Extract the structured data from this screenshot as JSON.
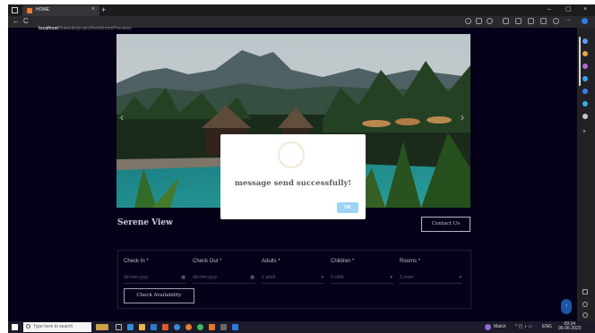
{
  "browser": {
    "tab_title": "HOME",
    "tab_close": "×",
    "new_tab": "+",
    "url_host": "localhost",
    "url_path": "/hotelsite/project/hotel/roomPreviews",
    "minimize": "–",
    "maximize": "▢",
    "close": "×",
    "back": "←",
    "refresh": "C"
  },
  "hero": {
    "prev_arrow": "‹",
    "next_arrow": "›"
  },
  "hotel": {
    "name": "Serene View",
    "contact_label": "Contact Us"
  },
  "booking": {
    "fields": [
      {
        "label": "Check In",
        "req": "*",
        "value": "dd-mm-yyyy",
        "right": "▦"
      },
      {
        "label": "Check Out",
        "req": "*",
        "value": "dd-mm-yyyy",
        "right": "▦"
      },
      {
        "label": "Adults",
        "req": "*",
        "value": "1 adult",
        "right": "▾"
      },
      {
        "label": "Children",
        "req": "*",
        "value": "0 child",
        "right": "▾"
      },
      {
        "label": "Rooms",
        "req": "*",
        "value": "1 room",
        "right": "▾"
      }
    ],
    "check_label": "Check Availability"
  },
  "scroll_top": "↑",
  "modal": {
    "message": "message send successfully!",
    "ok_label": "OK"
  },
  "taskbar": {
    "search_placeholder": "Type here to search",
    "weather": "Match",
    "lang": "ENG",
    "time": "09:24",
    "date": "06-06-2023"
  },
  "colors": {
    "page_bg": "#05021c",
    "ok_button": "#9fd3f3",
    "scroll_button": "#1f5fbf"
  }
}
